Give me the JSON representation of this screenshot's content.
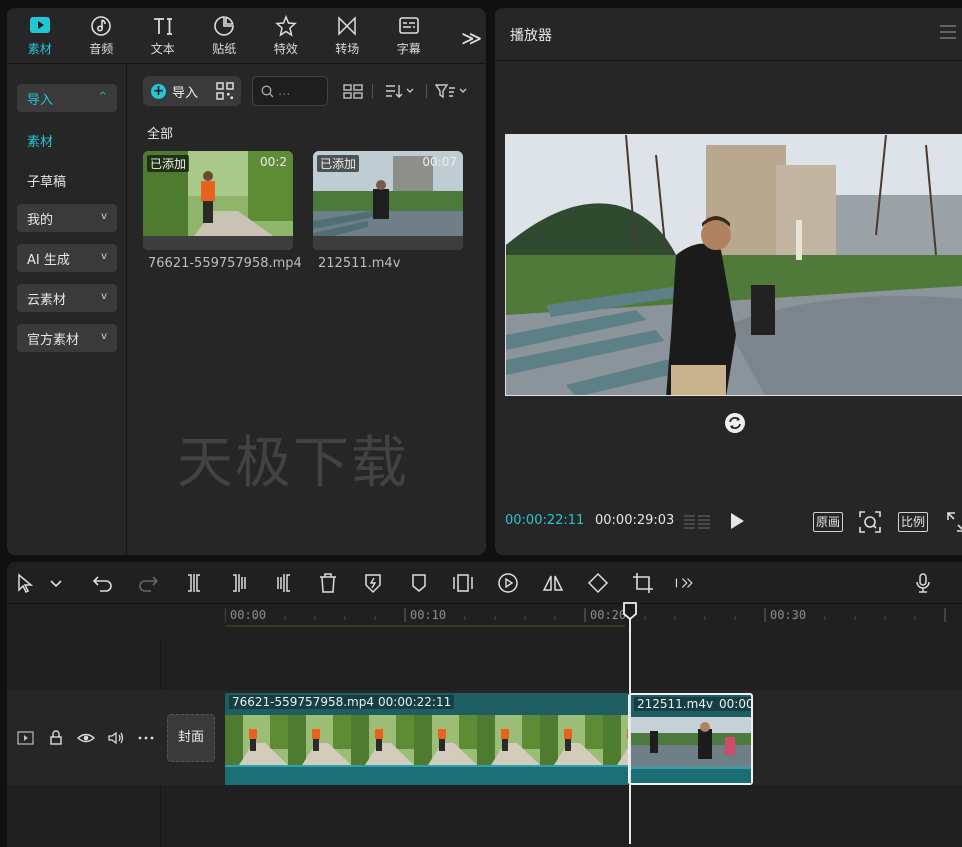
{
  "tabs": [
    {
      "label": "素材",
      "icon": "media-icon",
      "active": true
    },
    {
      "label": "音频",
      "icon": "audio-icon"
    },
    {
      "label": "文本",
      "icon": "text-icon"
    },
    {
      "label": "贴纸",
      "icon": "sticker-icon"
    },
    {
      "label": "特效",
      "icon": "effects-icon"
    },
    {
      "label": "转场",
      "icon": "transition-icon"
    },
    {
      "label": "字幕",
      "icon": "subtitle-icon"
    }
  ],
  "tab_more": "≫",
  "left_nav": {
    "import": "导入",
    "material": "素材",
    "subdraft": "子草稿",
    "mine": "我的",
    "ai_generate": "AI 生成",
    "cloud": "云素材",
    "official": "官方素材"
  },
  "media": {
    "import_label": "导入",
    "search_placeholder": "...",
    "section": "全部",
    "items": [
      {
        "badge": "已添加",
        "duration": "00:2",
        "name": "76621-559757958.mp4"
      },
      {
        "badge": "已添加",
        "duration": "00:07",
        "name": "212511.m4v"
      }
    ],
    "watermark": "天极下载"
  },
  "player": {
    "title": "播放器",
    "time_current": "00:00:22:11",
    "time_total": "00:00:29:03",
    "original_label": "原画",
    "ratio_label": "比例"
  },
  "timeline": {
    "ruler": [
      "00:00",
      "00:10",
      "00:20",
      "00:30"
    ],
    "cover_label": "封面",
    "clips": [
      {
        "name": "76621-559757958.mp4",
        "duration": "00:00:22:11"
      },
      {
        "name": "212511.m4v",
        "duration": "00:00"
      }
    ]
  },
  "colors": {
    "accent": "#22c7d6",
    "clip": "#1e5e63"
  }
}
